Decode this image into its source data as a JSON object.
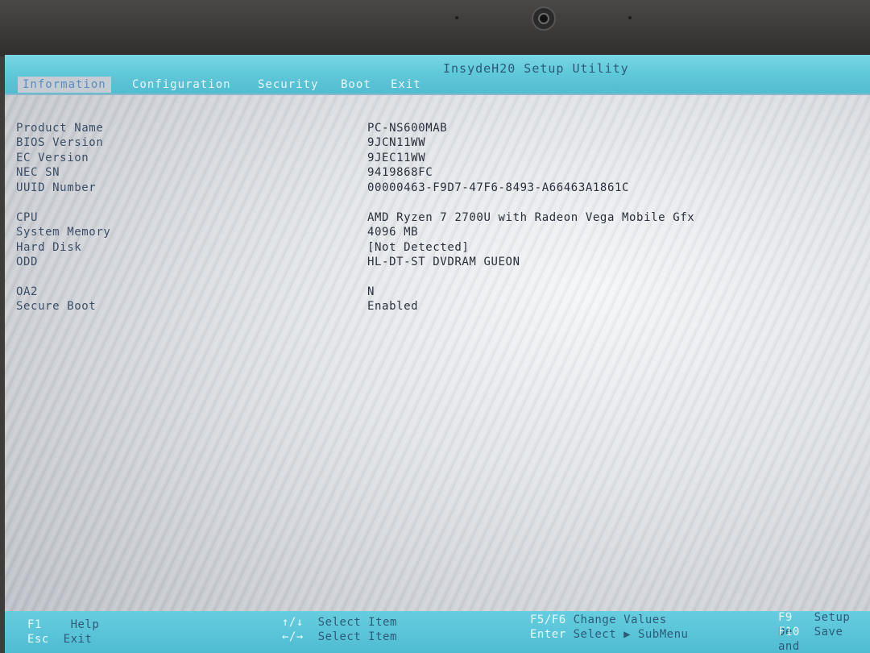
{
  "title": "InsydeH20 Setup Utility",
  "menu": [
    {
      "label": "Information",
      "active": true
    },
    {
      "label": "Configuration",
      "active": false
    },
    {
      "label": "Security",
      "active": false
    },
    {
      "label": "Boot",
      "active": false
    },
    {
      "label": "Exit",
      "active": false
    }
  ],
  "info": {
    "product_name": {
      "label": "Product Name",
      "value": "PC-NS600MAB"
    },
    "bios_version": {
      "label": "BIOS Version",
      "value": "9JCN11WW"
    },
    "ec_version": {
      "label": "EC Version",
      "value": "9JEC11WW"
    },
    "nec_sn": {
      "label": "NEC SN",
      "value": "9419868FC"
    },
    "uuid": {
      "label": "UUID Number",
      "value": "00000463-F9D7-47F6-8493-A66463A1861C"
    },
    "cpu": {
      "label": "CPU",
      "value": "AMD Ryzen 7 2700U with Radeon Vega Mobile Gfx"
    },
    "memory": {
      "label": "System Memory",
      "value": "4096 MB"
    },
    "hdd": {
      "label": "Hard Disk",
      "value": "[Not Detected]"
    },
    "odd": {
      "label": "ODD",
      "value": "HL-DT-ST DVDRAM GUEON"
    },
    "oa2": {
      "label": "OA2",
      "value": "N"
    },
    "secure_boot": {
      "label": "Secure Boot",
      "value": "Enabled"
    }
  },
  "footer": {
    "f1_key": "F1",
    "f1_desc": "Help",
    "esc_key": "Esc",
    "esc_desc": "Exit",
    "updown_key": "↑/↓",
    "updown_desc": "Select Item",
    "leftright_key": "←/→",
    "leftright_desc": "Select Item",
    "f5f6_key": "F5/F6",
    "f5f6_desc": "Change Values",
    "enter_key": "Enter",
    "enter_desc": "Select ▶ SubMenu",
    "f9_key": "F9",
    "f9_desc": "Setup De",
    "f10_key": "F10",
    "f10_desc": "Save and"
  }
}
